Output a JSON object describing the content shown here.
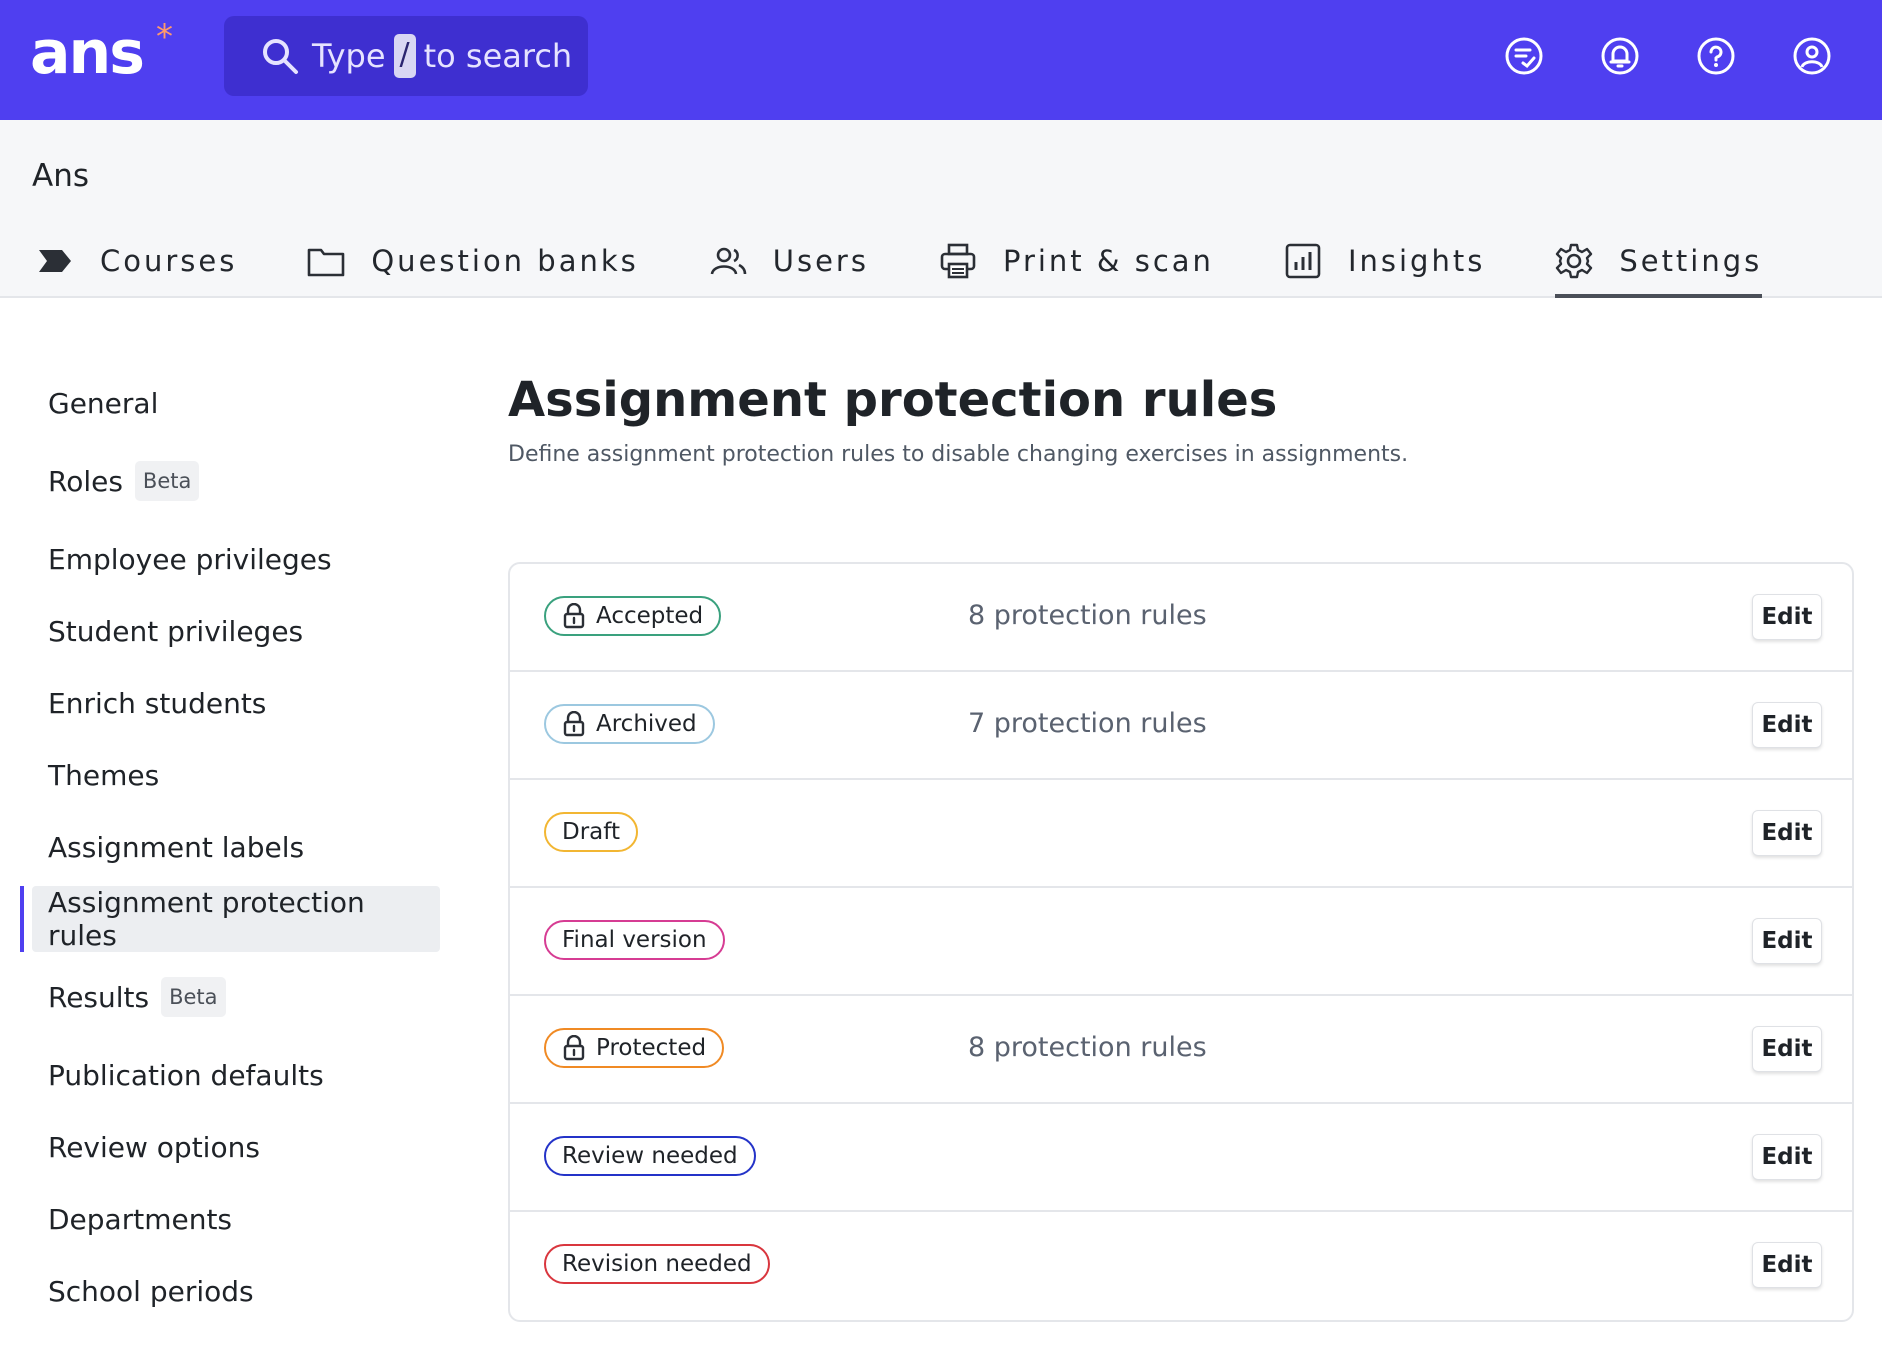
{
  "app": {
    "logo_text": "ans",
    "logo_mark": "*",
    "search": {
      "prefix": "Type",
      "key": "/",
      "suffix": "to search"
    },
    "top_icons": [
      "feedback-icon",
      "notifications-bell-icon",
      "help-icon",
      "account-icon"
    ]
  },
  "org_name": "Ans",
  "nav": [
    {
      "label": "Courses",
      "icon": "chevron-flag-icon"
    },
    {
      "label": "Question banks",
      "icon": "folder-icon"
    },
    {
      "label": "Users",
      "icon": "users-icon"
    },
    {
      "label": "Print & scan",
      "icon": "printer-icon"
    },
    {
      "label": "Insights",
      "icon": "chart-icon"
    },
    {
      "label": "Settings",
      "icon": "gear-icon",
      "active": true
    }
  ],
  "sidebar": {
    "items": [
      {
        "label": "General"
      },
      {
        "label": "Roles",
        "badge": "Beta"
      },
      {
        "label": "Employee privileges"
      },
      {
        "label": "Student privileges"
      },
      {
        "label": "Enrich students"
      },
      {
        "label": "Themes"
      },
      {
        "label": "Assignment labels"
      },
      {
        "label": "Assignment protection rules",
        "active": true
      },
      {
        "label": "Results",
        "badge": "Beta"
      },
      {
        "label": "Publication defaults"
      },
      {
        "label": "Review options"
      },
      {
        "label": "Departments"
      },
      {
        "label": "School periods"
      }
    ]
  },
  "main": {
    "title": "Assignment protection rules",
    "description": "Define assignment protection rules to disable changing exercises in assignments.",
    "edit_label": "Edit",
    "rules": [
      {
        "label": "Accepted",
        "locked": true,
        "count_text": "8 protection rules",
        "color": "#3aa17e"
      },
      {
        "label": "Archived",
        "locked": true,
        "count_text": "7 protection rules",
        "color": "#9cc8e0"
      },
      {
        "label": "Draft",
        "locked": false,
        "count_text": "",
        "color": "#f2b632"
      },
      {
        "label": "Final version",
        "locked": false,
        "count_text": "",
        "color": "#d63c93"
      },
      {
        "label": "Protected",
        "locked": true,
        "count_text": "8 protection rules",
        "color": "#f08a24"
      },
      {
        "label": "Review needed",
        "locked": false,
        "count_text": "",
        "color": "#2433c8"
      },
      {
        "label": "Revision needed",
        "locked": false,
        "count_text": "",
        "color": "#d9363e"
      }
    ]
  },
  "colors": {
    "brand": "#4f3ff0",
    "search_bg": "#3e2fd0",
    "accent": "#ff9a6b"
  }
}
